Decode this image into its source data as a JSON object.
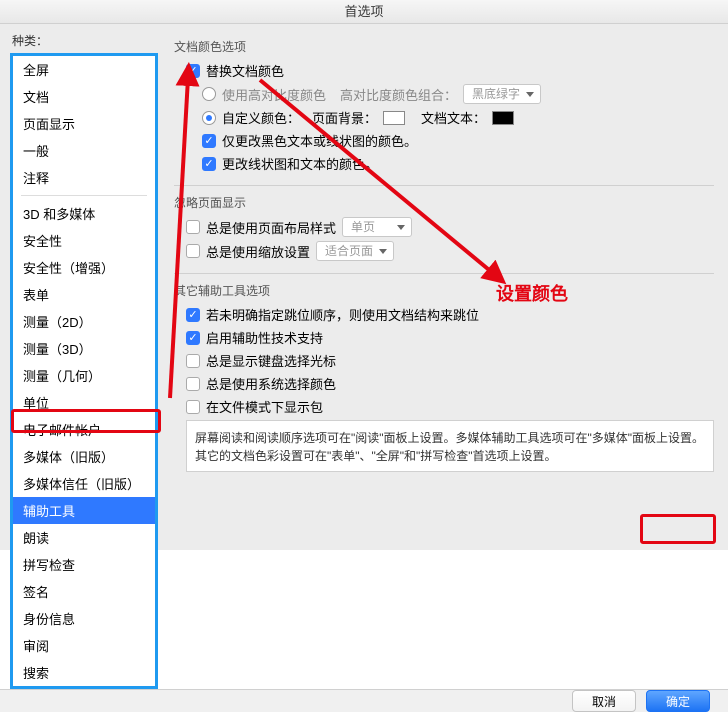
{
  "window": {
    "title": "首选项"
  },
  "sidebar": {
    "label": "种类：",
    "group1": [
      "全屏",
      "文档",
      "页面显示",
      "一般",
      "注释"
    ],
    "group2": [
      "3D 和多媒体",
      "安全性",
      "安全性（增强）",
      "表单",
      "测量（2D）",
      "测量（3D）",
      "测量（几何）",
      "单位",
      "电子邮件帐户",
      "多媒体（旧版）",
      "多媒体信任（旧版）",
      "辅助工具",
      "朗读",
      "拼写检查",
      "签名",
      "身份信息",
      "审阅",
      "搜索"
    ],
    "selected": "辅助工具"
  },
  "doc_color": {
    "title": "文档颜色选项",
    "replace_label": "替换文档颜色",
    "hc_label": "使用高对比度颜色",
    "hc_combo_label": "高对比度颜色组合：",
    "hc_combo_value": "黑底绿字",
    "custom_label": "自定义颜色：",
    "page_bg_label": "页面背景：",
    "doc_text_label": "文档文本：",
    "only_black_label": "仅更改黑色文本或线状图的颜色。",
    "change_line_label": "更改线状图和文本的颜色。"
  },
  "ignore_page": {
    "title": "忽略页面显示",
    "use_layout_label": "总是使用页面布局样式",
    "layout_value": "单页",
    "use_zoom_label": "总是使用缩放设置",
    "zoom_value": "适合页面"
  },
  "other_acc": {
    "title": "其它辅助工具选项",
    "tab_order_label": "若未明确指定跳位顺序，则使用文档结构来跳位",
    "enable_assist_label": "启用辅助性技术支持",
    "show_kb_cursor_label": "总是显示键盘选择光标",
    "use_sys_color_label": "总是使用系统选择颜色",
    "file_mode_label": "在文件模式下显示包",
    "info_text": "屏幕阅读和阅读顺序选项可在\"阅读\"面板上设置。多媒体辅助工具选项可在\"多媒体\"面板上设置。其它的文档色彩设置可在\"表单\"、\"全屏\"和\"拼写检查\"首选项上设置。"
  },
  "buttons": {
    "cancel": "取消",
    "ok": "确定"
  },
  "callout": {
    "text": "设置颜色"
  }
}
